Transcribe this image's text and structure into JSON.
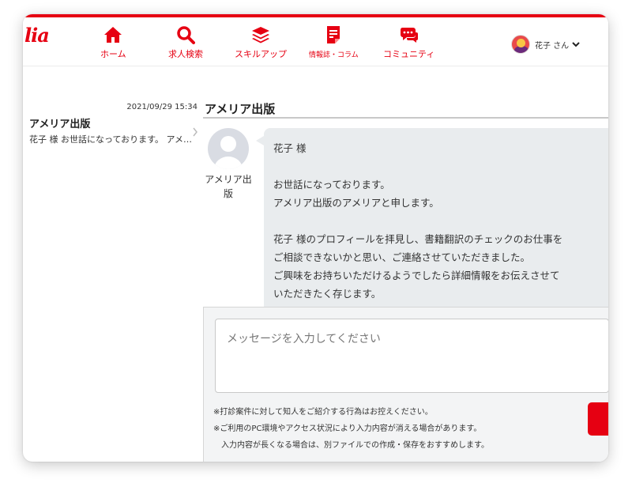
{
  "brand": {
    "logo_text": "lia",
    "accent": "#e60012"
  },
  "nav": {
    "items": [
      {
        "label": "ホーム",
        "icon": "home-icon"
      },
      {
        "label": "求人検索",
        "icon": "search-icon"
      },
      {
        "label": "スキルアップ",
        "icon": "layers-icon"
      },
      {
        "label": "情報誌・コラム",
        "icon": "document-icon"
      },
      {
        "label": "コミュニティ",
        "icon": "chat-icon"
      }
    ]
  },
  "user": {
    "name": "花子 さん",
    "icon": "chevron-down-icon"
  },
  "thread": {
    "date": "2021/09/29 15:34",
    "title": "アメリア出版",
    "preview": "花子 様 お世話になっております。 アメリア出版のアメリアと申します。"
  },
  "conversation": {
    "title": "アメリア出版",
    "sender_name": "アメリア出版",
    "message": "花子 様\n\nお世話になっております。\nアメリア出版のアメリアと申します。\n\n花子 様のプロフィールを拝見し、書籍翻訳のチェックのお仕事を\nご相談できないかと思い、ご連絡させていただきました。\nご興味をお持ちいただけるようでしたら詳細情報をお伝えさせて\nいただきたく存じます。"
  },
  "compose": {
    "placeholder": "メッセージを入力してください",
    "notes": [
      "※打診案件に対して知人をご紹介する行為はお控えください。",
      "※ご利用のPC環境やアクセス状況により入力内容が消える場合があります。",
      "　入力内容が長くなる場合は、別ファイルでの作成・保存をおすすめします。"
    ]
  }
}
